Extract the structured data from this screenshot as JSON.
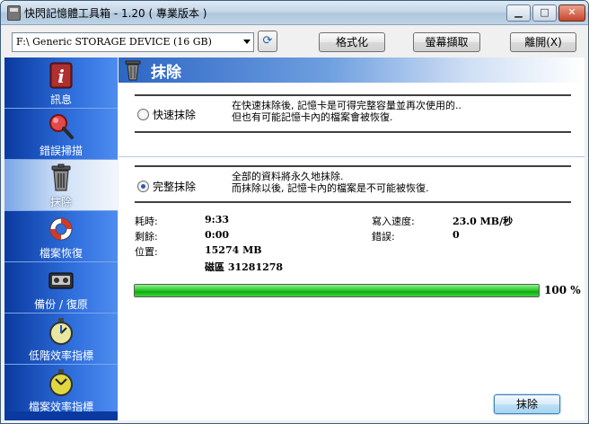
{
  "window": {
    "title": "快閃記憶體工具箱 - 1.20 ( 專業版本 )"
  },
  "toolbar": {
    "device": "F:\\ Generic STORAGE DEVICE (16 GB)",
    "format_label": "格式化",
    "capture_label": "螢幕擷取",
    "quit_label": "離開(X)"
  },
  "sidebar": {
    "items": [
      {
        "label": "訊息",
        "icon": "info-icon"
      },
      {
        "label": "錯誤掃描",
        "icon": "magnifier-icon"
      },
      {
        "label": "抹除",
        "icon": "trash-icon",
        "active": true
      },
      {
        "label": "檔案恢復",
        "icon": "lifebuoy-icon"
      },
      {
        "label": "備份 / 復原",
        "icon": "tape-icon"
      },
      {
        "label": "低階效率指標",
        "icon": "stopwatch-icon"
      },
      {
        "label": "檔案效率指標",
        "icon": "stopwatch-icon"
      }
    ]
  },
  "main": {
    "title": "抹除",
    "quick": {
      "label": "快速抹除",
      "desc_line1": "在快速抹除後, 記憶卡是可得完整容量並再次使用的..",
      "desc_line2": "但也有可能記憶卡內的檔案會被恢復."
    },
    "full": {
      "label": "完整抹除",
      "desc_line1": "全部的資料將永久地抹除.",
      "desc_line2": "而抹除以後, 記憶卡內的檔案是不可能被恢復."
    },
    "stats": {
      "elapsed_key": "耗時:",
      "elapsed_val": "9:33",
      "remaining_key": "剩餘:",
      "remaining_val": "0:00",
      "position_key": "位置:",
      "position_val": "15274 MB",
      "sector_val": "磁區 31281278",
      "write_speed_key": "寫入速度:",
      "write_speed_val": "23.0 MB/秒",
      "errors_key": "錯誤:",
      "errors_val": "0"
    },
    "progress": {
      "percent": 100,
      "label": "100 %"
    },
    "wipe_button": "抹除"
  },
  "colors": {
    "accent": "#2c66c4",
    "progress": "#2ecc2e",
    "sidebar": "#1d55c8"
  }
}
